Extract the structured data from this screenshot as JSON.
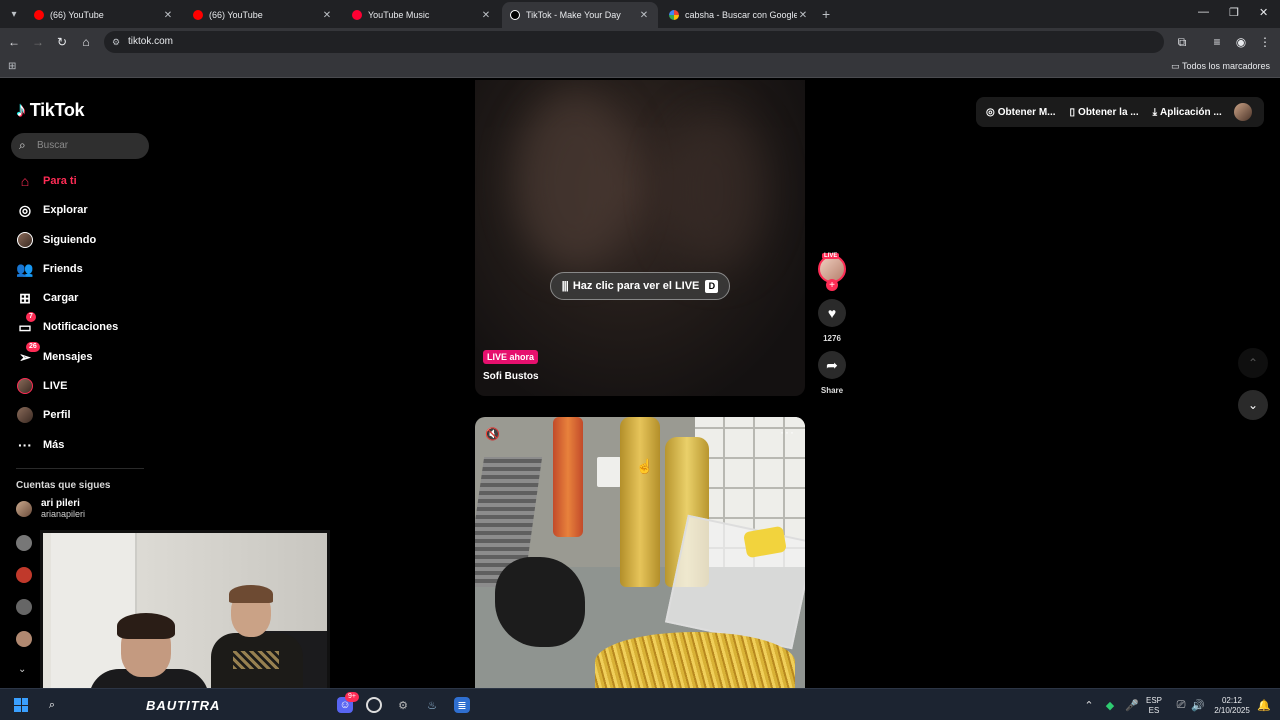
{
  "browser": {
    "tabs": [
      {
        "title": "(66) YouTube",
        "icon": "youtube-icon"
      },
      {
        "title": "(66) YouTube",
        "icon": "youtube-icon"
      },
      {
        "title": "YouTube Music",
        "icon": "youtube-music-icon"
      },
      {
        "title": "TikTok - Make Your Day",
        "icon": "tiktok-icon",
        "active": true
      },
      {
        "title": "cabsha - Buscar con Google",
        "icon": "google-icon"
      }
    ],
    "url": "tiktok.com",
    "bookmarks_all": "Todos los marcadores"
  },
  "tiktok": {
    "logo_text": "TikTok",
    "search_placeholder": "Buscar",
    "nav": [
      {
        "label": "Para ti",
        "icon": "home-icon",
        "active": true
      },
      {
        "label": "Explorar",
        "icon": "compass-icon"
      },
      {
        "label": "Siguiendo",
        "icon": "following-avatar-icon"
      },
      {
        "label": "Friends",
        "icon": "friends-icon"
      },
      {
        "label": "Cargar",
        "icon": "upload-icon"
      },
      {
        "label": "Notificaciones",
        "icon": "notifications-icon",
        "badge": "7"
      },
      {
        "label": "Mensajes",
        "icon": "messages-icon",
        "badge": "26"
      },
      {
        "label": "LIVE",
        "icon": "live-icon"
      },
      {
        "label": "Perfil",
        "icon": "profile-icon"
      },
      {
        "label": "Más",
        "icon": "more-icon"
      }
    ],
    "following_title": "Cuentas que sigues",
    "following": [
      {
        "name": "ari pileri",
        "username": "arianapileri"
      }
    ],
    "top_actions": [
      {
        "label": "Obtener M...",
        "icon": "coins-icon"
      },
      {
        "label": "Obtener la ...",
        "icon": "phone-icon"
      },
      {
        "label": "Aplicación ...",
        "icon": "download-icon"
      }
    ],
    "live_card": {
      "button_label": "Haz clic para ver el LIVE",
      "key_hint": "D",
      "tag": "LIVE ahora",
      "name": "Sofi Bustos"
    },
    "actions": {
      "avatar_live": "LIVE",
      "likes": "1276",
      "share_label": "Share"
    }
  },
  "taskbar": {
    "streamer_name": "BAUTITRA",
    "lang_top": "ESP",
    "lang_bottom": "ES",
    "time": "02:12",
    "date": "2/10/2025",
    "discord_badge": "9+"
  }
}
